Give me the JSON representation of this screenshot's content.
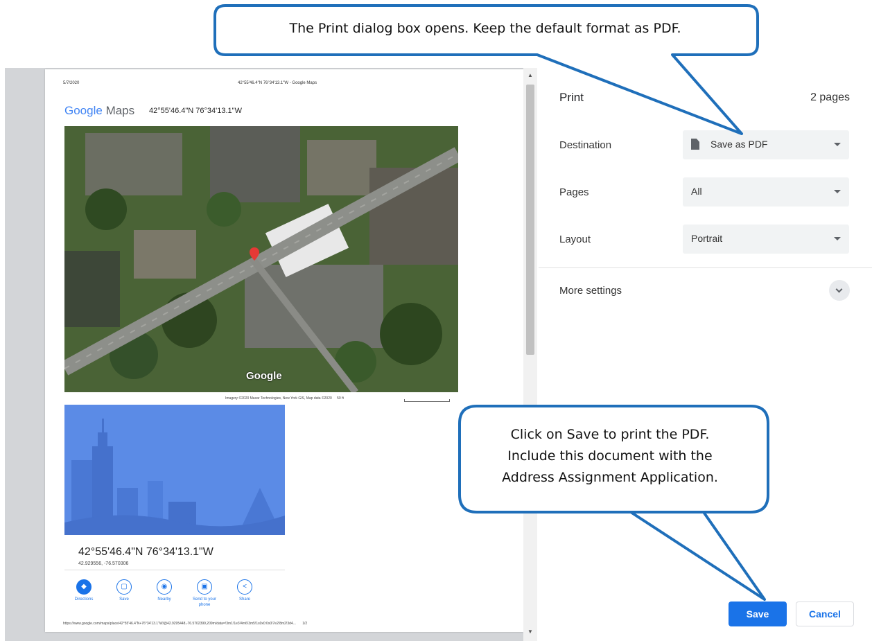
{
  "preview": {
    "header_date": "5/7/2020",
    "header_title": "42°55'46.4\"N 76°34'13.1\"W - Google Maps",
    "logo_google": "Google",
    "logo_maps": "Maps",
    "coords_heading": "42°55'46.4\"N 76°34'13.1\"W",
    "aerial_watermark": "Google",
    "imagery_credit": "Imagery ©2020 Maxar Technologies, New York GIS, Map data ©2020",
    "scale_label": "50 ft",
    "place_coords": "42°55'46.4\"N 76°34'13.1\"W",
    "place_decimal": "42.929556, -76.570306",
    "actions": [
      {
        "label": "Directions",
        "icon": "directions-icon",
        "glyph": "◆"
      },
      {
        "label": "Save",
        "icon": "bookmark-icon",
        "glyph": "▢"
      },
      {
        "label": "Nearby",
        "icon": "nearby-icon",
        "glyph": "◉"
      },
      {
        "label": "Send to your phone",
        "icon": "phone-icon",
        "glyph": "▣"
      },
      {
        "label": "Share",
        "icon": "share-icon",
        "glyph": "<"
      }
    ],
    "footer_url": "https://www.google.com/maps/place/42°55'46.4\"N+76°34'13.1\"W/@42.9295448,-76.5702399,209m/data=!3m1!1e3!4m6!3m5!1s0x0:0x0!7e2!8m2!3d4...",
    "page_number": "1/2"
  },
  "print_panel": {
    "title": "Print",
    "page_count": "2 pages",
    "destination_label": "Destination",
    "destination_value": "Save as PDF",
    "pages_label": "Pages",
    "pages_value": "All",
    "layout_label": "Layout",
    "layout_value": "Portrait",
    "more_settings_label": "More settings",
    "save_label": "Save",
    "cancel_label": "Cancel"
  },
  "callouts": {
    "top_text": "The Print dialog box opens. Keep the default format as PDF.",
    "bottom_lines": [
      "Click on Save to print the PDF.",
      "Include this document with the",
      "Address Assignment Application."
    ]
  },
  "colors": {
    "accent": "#1a73e8",
    "callout_border": "#1f6fba",
    "preview_bg": "#d3d5d8"
  }
}
